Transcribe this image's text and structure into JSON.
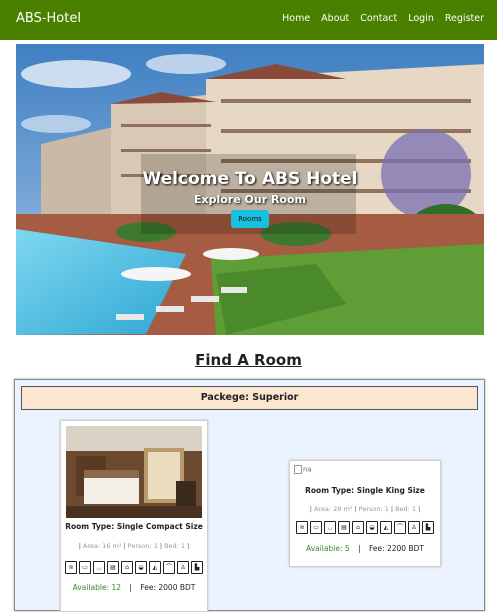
{
  "nav": {
    "brand": "ABS-Hotel",
    "links": [
      "Home",
      "About",
      "Contact",
      "Login",
      "Register"
    ],
    "color": "#4a8000"
  },
  "hero": {
    "title": "Welcome To ABS Hotel",
    "subtitle": "Explore Our Room",
    "button_label": "Rooms",
    "button_color": "#17c0dd"
  },
  "section_title": "Find A Room",
  "package": {
    "label": "Packege: Superior",
    "rooms": [
      {
        "type": "Room Type: Single Compact Size",
        "area": "Area: 16 m²",
        "person": "Person: 1",
        "bed": "Bed: 1",
        "available_label": "Available: 12",
        "fee": "Fee: 2000 BDT"
      },
      {
        "image_alt": "na",
        "type": "Room Type: Single King Size",
        "area": "Area: 28 m²",
        "person": "Person: 1",
        "bed": "Bed: 1",
        "available_label": "Available: 5",
        "fee": "Fee: 2200 BDT"
      }
    ],
    "amenity_icons": [
      "wifi-icon",
      "tv-icon",
      "bathtub-icon",
      "fridge-icon",
      "shower-icon",
      "toilet-icon",
      "iron-icon",
      "hanger-icon",
      "lamp-icon",
      "sofa-icon"
    ]
  }
}
